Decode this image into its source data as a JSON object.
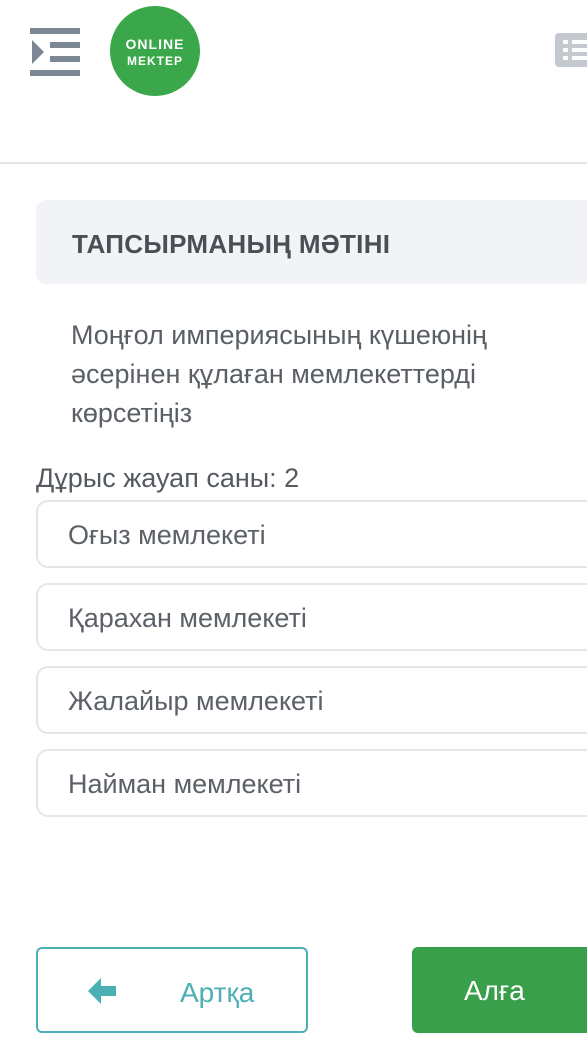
{
  "header": {
    "menu_icon": "hamburger-indent-icon",
    "logo": {
      "line1": "ONLINE",
      "line2": "MEKTEP",
      "color": "#3aa84a"
    },
    "list_icon": "list-icon"
  },
  "task": {
    "title": "ТАПСЫРМАНЫҢ МӘТІНІ",
    "question": "Моңғол империясының күшеюнің әсерінен құлаған мемлекеттерді көрсетіңіз",
    "answer_count": "Дұрыс жауап саны: 2"
  },
  "options": [
    {
      "label": "Оғыз мемлекеті"
    },
    {
      "label": "Қарахан мемлекеті"
    },
    {
      "label": "Жалайыр мемлекеті"
    },
    {
      "label": "Найман мемлекеті"
    }
  ],
  "nav": {
    "back_label": "Артқа",
    "back_icon": "arrow-left-icon",
    "next_label": "Алға"
  },
  "colors": {
    "accent_teal": "#4bb0b4",
    "primary_green": "#3a9f4b"
  }
}
